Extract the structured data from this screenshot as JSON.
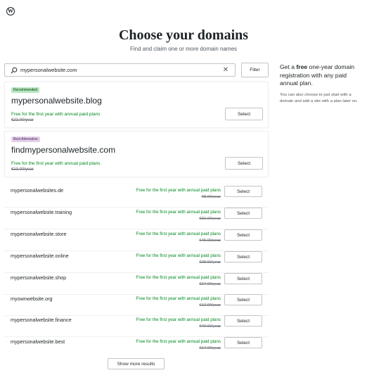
{
  "header": {
    "logo_icon": "wordpress-logo-icon",
    "title": "Choose your domains",
    "subtitle": "Find and claim one or more domain names"
  },
  "search": {
    "value": "mypersonalwebsite.com",
    "search_icon": "search-icon",
    "clear_icon": "close-icon",
    "filter_label": "Filter"
  },
  "promo": {
    "prefix": "Get a ",
    "bold": "free",
    "suffix": " one-year domain registration with any paid annual plan.",
    "sub": "You can also choose to just start with a domain and add a site with a plan later on."
  },
  "featured": [
    {
      "badge": "Recommended",
      "domain": "mypersonalwebsite.blog",
      "free_text": "Free for the first year with annual paid plans",
      "price": "€21.00/year",
      "select_label": "Select"
    },
    {
      "badge": "Best Alternative",
      "domain": "findmypersonalwebsite.com",
      "free_text": "Free for the first year with annual paid plans",
      "price": "€13.00/year",
      "select_label": "Select"
    }
  ],
  "results": [
    {
      "domain": "mypersonalwebsites.de",
      "free_text": "Free for the first year with annual paid plans",
      "price": "€8.00/year",
      "select_label": "Select"
    },
    {
      "domain": "mypersonalwebsite.training",
      "free_text": "Free for the first year with annual paid plans",
      "price": "€31.00/year",
      "select_label": "Select"
    },
    {
      "domain": "mypersonalwebsite.store",
      "free_text": "Free for the first year with annual paid plans",
      "price": "€45.00/year",
      "select_label": "Select"
    },
    {
      "domain": "mypersonalwebsite.online",
      "free_text": "Free for the first year with annual paid plans",
      "price": "€28.00/year",
      "select_label": "Select"
    },
    {
      "domain": "mypersonalwebsite.shop",
      "free_text": "Free for the first year with annual paid plans",
      "price": "€27.00/year",
      "select_label": "Select"
    },
    {
      "domain": "myownwebsite.org",
      "free_text": "Free for the first year with annual paid plans",
      "price": "€12.00/year",
      "select_label": "Select"
    },
    {
      "domain": "mypersonalwebsite.finance",
      "free_text": "Free for the first year with annual paid plans",
      "price": "€49.00/year",
      "select_label": "Select"
    },
    {
      "domain": "mypersonalwebsite.best",
      "free_text": "Free for the first year with annual paid plans",
      "price": "€17.00/year",
      "select_label": "Select"
    }
  ],
  "more_label": "Show more results",
  "colors": {
    "free_text": "#008a20",
    "recommended_badge": "#b8e6bf",
    "alternative_badge": "#e5cfe8"
  }
}
